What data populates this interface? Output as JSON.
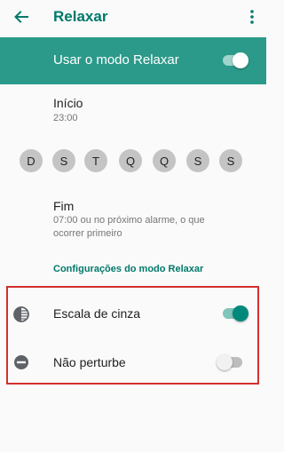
{
  "app_bar": {
    "title": "Relaxar",
    "back_icon": "arrow-back-icon",
    "menu_icon": "more-vert-icon"
  },
  "master_switch": {
    "label": "Usar o modo Relaxar",
    "state": "on"
  },
  "start": {
    "title": "Início",
    "value": "23:00"
  },
  "days": [
    "D",
    "S",
    "T",
    "Q",
    "Q",
    "S",
    "S"
  ],
  "end": {
    "title": "Fim",
    "value": "07:00 ou no próximo alarme, o que ocorrer primeiro"
  },
  "settings_link": "Configurações do modo Relaxar",
  "options": [
    {
      "label": "Escala de cinza",
      "icon": "grayscale-icon",
      "state": "on"
    },
    {
      "label": "Não perturbe",
      "icon": "do-not-disturb-icon",
      "state": "off"
    }
  ],
  "colors": {
    "accent": "#00796b",
    "header_bar": "#2b9a8a",
    "day_chip": "#c4c4c4",
    "highlight": "#d32f2f"
  }
}
